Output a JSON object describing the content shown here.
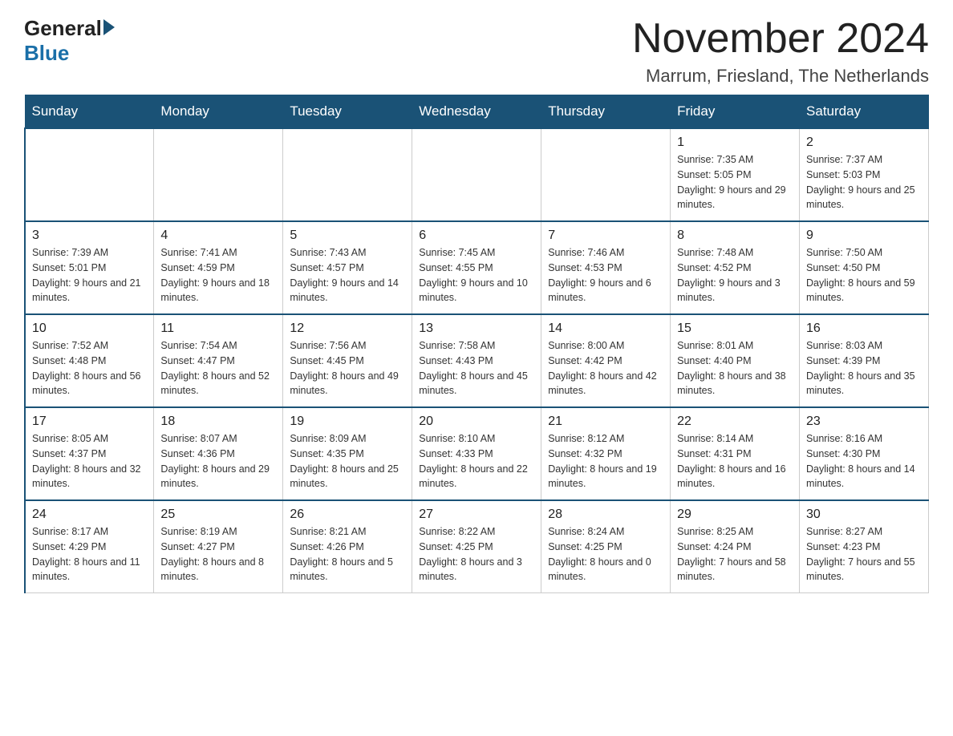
{
  "logo": {
    "general": "General",
    "blue": "Blue"
  },
  "title": "November 2024",
  "location": "Marrum, Friesland, The Netherlands",
  "days_of_week": [
    "Sunday",
    "Monday",
    "Tuesday",
    "Wednesday",
    "Thursday",
    "Friday",
    "Saturday"
  ],
  "weeks": [
    [
      {
        "day": "",
        "info": ""
      },
      {
        "day": "",
        "info": ""
      },
      {
        "day": "",
        "info": ""
      },
      {
        "day": "",
        "info": ""
      },
      {
        "day": "",
        "info": ""
      },
      {
        "day": "1",
        "info": "Sunrise: 7:35 AM\nSunset: 5:05 PM\nDaylight: 9 hours and 29 minutes."
      },
      {
        "day": "2",
        "info": "Sunrise: 7:37 AM\nSunset: 5:03 PM\nDaylight: 9 hours and 25 minutes."
      }
    ],
    [
      {
        "day": "3",
        "info": "Sunrise: 7:39 AM\nSunset: 5:01 PM\nDaylight: 9 hours and 21 minutes."
      },
      {
        "day": "4",
        "info": "Sunrise: 7:41 AM\nSunset: 4:59 PM\nDaylight: 9 hours and 18 minutes."
      },
      {
        "day": "5",
        "info": "Sunrise: 7:43 AM\nSunset: 4:57 PM\nDaylight: 9 hours and 14 minutes."
      },
      {
        "day": "6",
        "info": "Sunrise: 7:45 AM\nSunset: 4:55 PM\nDaylight: 9 hours and 10 minutes."
      },
      {
        "day": "7",
        "info": "Sunrise: 7:46 AM\nSunset: 4:53 PM\nDaylight: 9 hours and 6 minutes."
      },
      {
        "day": "8",
        "info": "Sunrise: 7:48 AM\nSunset: 4:52 PM\nDaylight: 9 hours and 3 minutes."
      },
      {
        "day": "9",
        "info": "Sunrise: 7:50 AM\nSunset: 4:50 PM\nDaylight: 8 hours and 59 minutes."
      }
    ],
    [
      {
        "day": "10",
        "info": "Sunrise: 7:52 AM\nSunset: 4:48 PM\nDaylight: 8 hours and 56 minutes."
      },
      {
        "day": "11",
        "info": "Sunrise: 7:54 AM\nSunset: 4:47 PM\nDaylight: 8 hours and 52 minutes."
      },
      {
        "day": "12",
        "info": "Sunrise: 7:56 AM\nSunset: 4:45 PM\nDaylight: 8 hours and 49 minutes."
      },
      {
        "day": "13",
        "info": "Sunrise: 7:58 AM\nSunset: 4:43 PM\nDaylight: 8 hours and 45 minutes."
      },
      {
        "day": "14",
        "info": "Sunrise: 8:00 AM\nSunset: 4:42 PM\nDaylight: 8 hours and 42 minutes."
      },
      {
        "day": "15",
        "info": "Sunrise: 8:01 AM\nSunset: 4:40 PM\nDaylight: 8 hours and 38 minutes."
      },
      {
        "day": "16",
        "info": "Sunrise: 8:03 AM\nSunset: 4:39 PM\nDaylight: 8 hours and 35 minutes."
      }
    ],
    [
      {
        "day": "17",
        "info": "Sunrise: 8:05 AM\nSunset: 4:37 PM\nDaylight: 8 hours and 32 minutes."
      },
      {
        "day": "18",
        "info": "Sunrise: 8:07 AM\nSunset: 4:36 PM\nDaylight: 8 hours and 29 minutes."
      },
      {
        "day": "19",
        "info": "Sunrise: 8:09 AM\nSunset: 4:35 PM\nDaylight: 8 hours and 25 minutes."
      },
      {
        "day": "20",
        "info": "Sunrise: 8:10 AM\nSunset: 4:33 PM\nDaylight: 8 hours and 22 minutes."
      },
      {
        "day": "21",
        "info": "Sunrise: 8:12 AM\nSunset: 4:32 PM\nDaylight: 8 hours and 19 minutes."
      },
      {
        "day": "22",
        "info": "Sunrise: 8:14 AM\nSunset: 4:31 PM\nDaylight: 8 hours and 16 minutes."
      },
      {
        "day": "23",
        "info": "Sunrise: 8:16 AM\nSunset: 4:30 PM\nDaylight: 8 hours and 14 minutes."
      }
    ],
    [
      {
        "day": "24",
        "info": "Sunrise: 8:17 AM\nSunset: 4:29 PM\nDaylight: 8 hours and 11 minutes."
      },
      {
        "day": "25",
        "info": "Sunrise: 8:19 AM\nSunset: 4:27 PM\nDaylight: 8 hours and 8 minutes."
      },
      {
        "day": "26",
        "info": "Sunrise: 8:21 AM\nSunset: 4:26 PM\nDaylight: 8 hours and 5 minutes."
      },
      {
        "day": "27",
        "info": "Sunrise: 8:22 AM\nSunset: 4:25 PM\nDaylight: 8 hours and 3 minutes."
      },
      {
        "day": "28",
        "info": "Sunrise: 8:24 AM\nSunset: 4:25 PM\nDaylight: 8 hours and 0 minutes."
      },
      {
        "day": "29",
        "info": "Sunrise: 8:25 AM\nSunset: 4:24 PM\nDaylight: 7 hours and 58 minutes."
      },
      {
        "day": "30",
        "info": "Sunrise: 8:27 AM\nSunset: 4:23 PM\nDaylight: 7 hours and 55 minutes."
      }
    ]
  ]
}
